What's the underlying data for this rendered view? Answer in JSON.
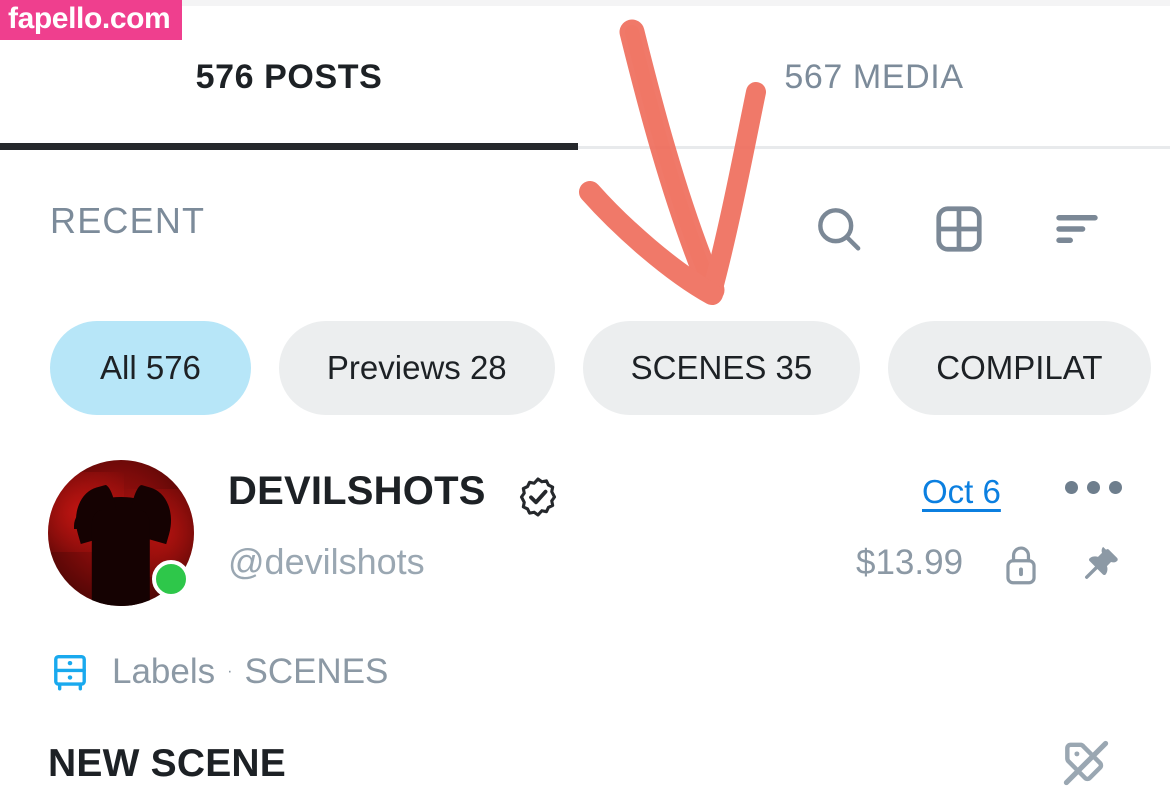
{
  "watermark": {
    "text": "fapello.com",
    "color": "#ef3f8e"
  },
  "tabs": [
    {
      "label": "576 POSTS",
      "active": true
    },
    {
      "label": "567 MEDIA",
      "active": false
    }
  ],
  "toolbar": {
    "section_label": "RECENT",
    "icons": [
      {
        "name": "search-icon",
        "label": "Search"
      },
      {
        "name": "grid-view-icon",
        "label": "Grid view"
      },
      {
        "name": "sort-icon",
        "label": "Sort"
      }
    ]
  },
  "filter_chips": [
    {
      "label": "All 576",
      "selected": true
    },
    {
      "label": "Previews 28",
      "selected": false
    },
    {
      "label": "SCENES 35",
      "selected": false
    },
    {
      "label": "COMPILAT",
      "selected": false
    }
  ],
  "post": {
    "display_name": "DEVILSHOTS",
    "verified": true,
    "handle": "@devilshots",
    "online": true,
    "date": "Oct 6",
    "price": "$13.99",
    "locked": true,
    "pinned": true,
    "labels_label": "Labels",
    "labels_separator": "·",
    "labels_value": "SCENES",
    "title": "NEW SCENE"
  },
  "colors": {
    "accent_blue": "#0b7fe0",
    "chip_selected": "#b7e6f8",
    "chip_default": "#eceeef",
    "muted_text": "#8c99a5",
    "dark_text": "#1d2125",
    "online_green": "#2ec74a",
    "annotation_red": "#ef6e5d",
    "watermark_pink": "#ef3f8e",
    "label_icon_blue": "#19a9ee"
  },
  "annotation": {
    "type": "hand-drawn-arrow",
    "points_to": "SCENES 35"
  }
}
